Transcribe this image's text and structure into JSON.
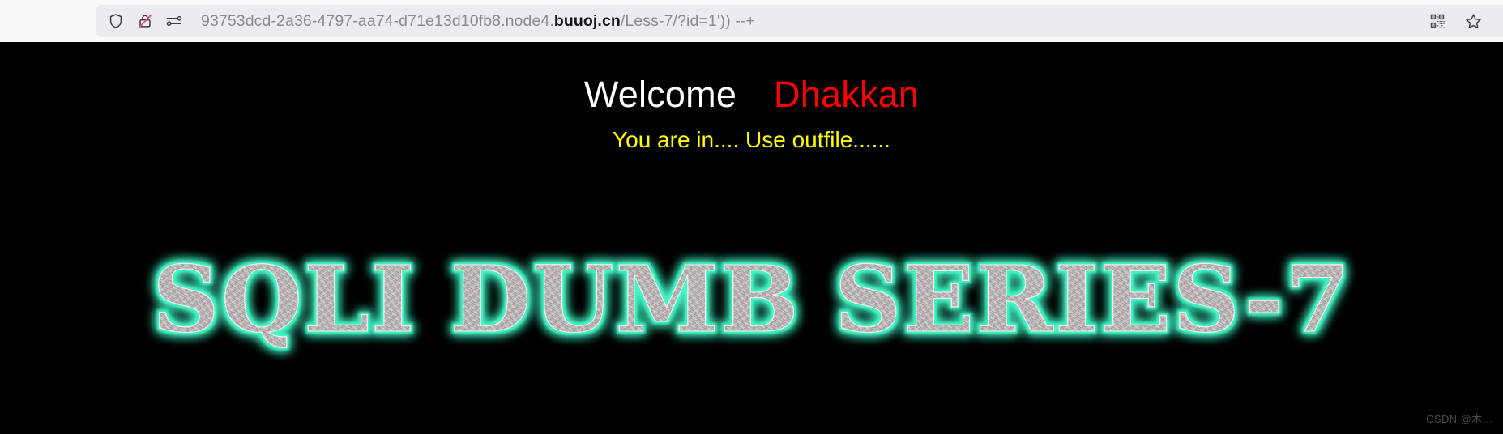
{
  "browser": {
    "url": {
      "prefix": "93753dcd-2a36-4797-aa74-d71e13d10fb8.node4.",
      "host": "buuoj.cn",
      "path": "/Less-7/?id=1')) --+",
      "full": "93753dcd-2a36-4797-aa74-d71e13d10fb8.node4.buuoj.cn/Less-7/?id=1')) --+"
    },
    "icons": {
      "shield": "shield-icon",
      "insecure_lock": "insecure-lock-icon",
      "permissions": "permissions-icon",
      "qr_code": "qr-code-icon",
      "bookmark_star": "bookmark-star-icon"
    }
  },
  "page": {
    "welcome": "Welcome",
    "username": "Dhakkan",
    "message": "You are in.... Use outfile......",
    "banner_text": "SQLI DUMB SERIES-7",
    "watermark": "CSDN @木…",
    "colors": {
      "background": "#000000",
      "welcome": "#ffffff",
      "username": "#ff0000",
      "message": "#ffff00",
      "banner_glow": "#3ff0c0",
      "banner_metal_light": "#d8d4d4",
      "banner_metal_dark": "#8a8486"
    }
  }
}
